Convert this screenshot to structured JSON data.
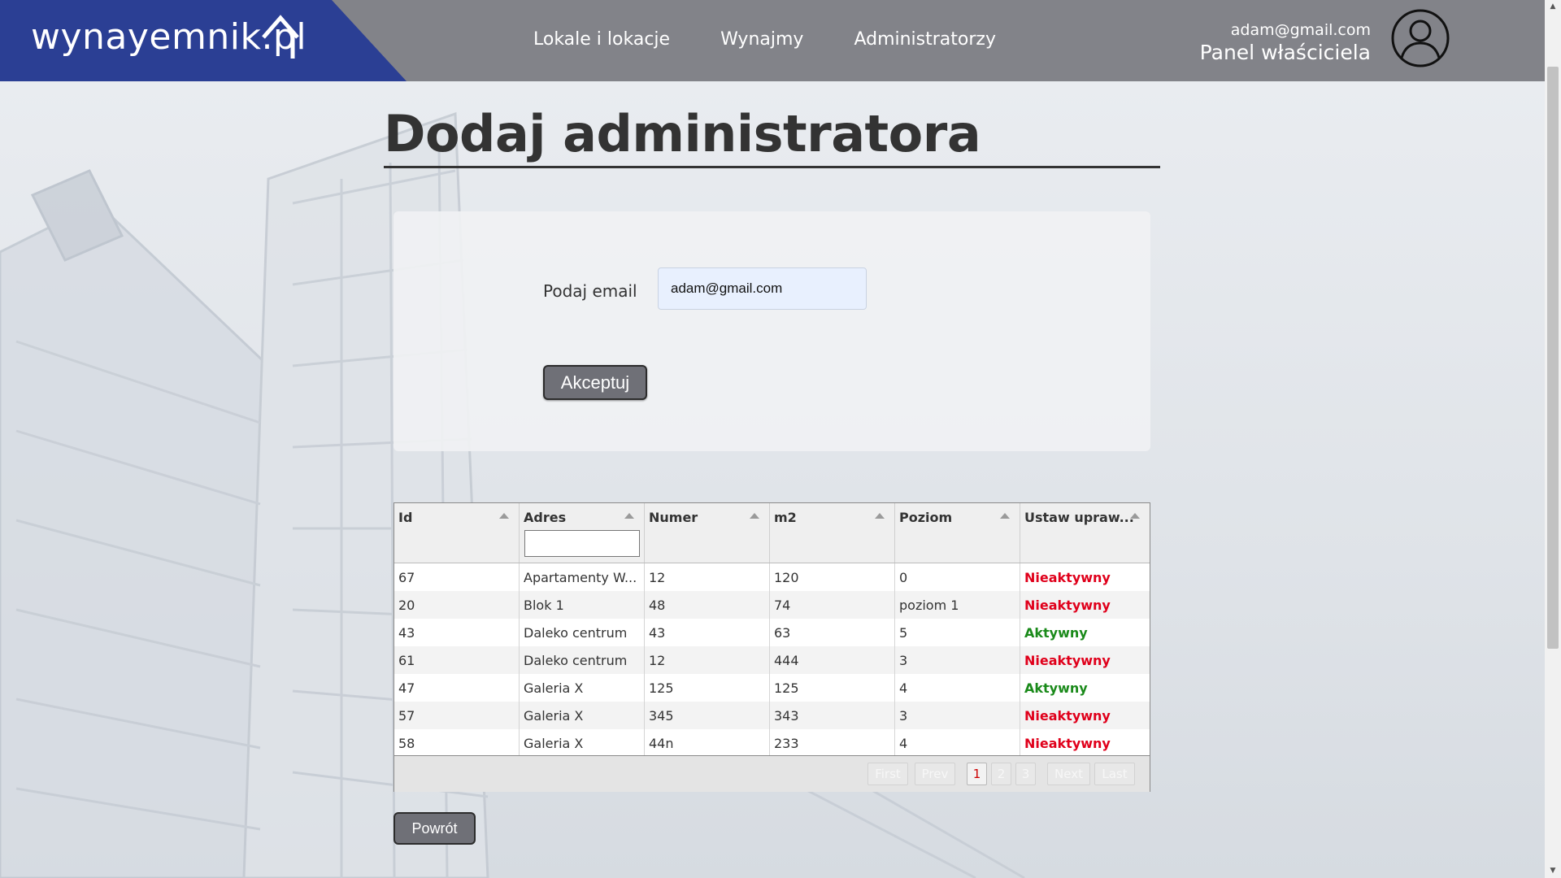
{
  "header": {
    "logo_text": "wynayemnik.pl",
    "nav": [
      "Lokale i lokacje",
      "Wynajmy",
      "Administratorzy"
    ],
    "user_email": "adam@gmail.com",
    "user_role": "Panel właściciela",
    "avatar_icon": "user-circle-icon",
    "colors": {
      "bar": "#828389",
      "logo_bg": "#2b3f94"
    }
  },
  "page": {
    "title": "Dodaj administratora"
  },
  "form": {
    "email_label": "Podaj email",
    "email_value": "adam@gmail.com",
    "accept_label": "Akceptuj"
  },
  "grid": {
    "columns": [
      "Id",
      "Adres",
      "Numer",
      "m2",
      "Poziom",
      "Ustaw upraw..."
    ],
    "rows": [
      {
        "id": "67",
        "adres": "Apartamenty W...",
        "numer": "12",
        "m2": "120",
        "poziom": "0",
        "status": "Nieaktywny"
      },
      {
        "id": "20",
        "adres": "Blok 1",
        "numer": "48",
        "m2": "74",
        "poziom": "poziom 1",
        "status": "Nieaktywny"
      },
      {
        "id": "43",
        "adres": "Daleko centrum",
        "numer": "43",
        "m2": "63",
        "poziom": "5",
        "status": "Aktywny"
      },
      {
        "id": "61",
        "adres": "Daleko centrum",
        "numer": "12",
        "m2": "444",
        "poziom": "3",
        "status": "Nieaktywny"
      },
      {
        "id": "47",
        "adres": "Galeria X",
        "numer": "125",
        "m2": "125",
        "poziom": "4",
        "status": "Aktywny"
      },
      {
        "id": "57",
        "adres": "Galeria X",
        "numer": "345",
        "m2": "343",
        "poziom": "3",
        "status": "Nieaktywny"
      },
      {
        "id": "58",
        "adres": "Galeria X",
        "numer": "44n",
        "m2": "233",
        "poziom": "4",
        "status": "Nieaktywny"
      }
    ],
    "pager": {
      "first": "First",
      "prev": "Prev",
      "pages": [
        "1",
        "2",
        "3"
      ],
      "current_page": "1",
      "next": "Next",
      "last": "Last"
    },
    "status_colors": {
      "Aktywny": "#1a8a1a",
      "Nieaktywny": "#e0001b"
    }
  },
  "footer": {
    "back_label": "Powrót"
  }
}
